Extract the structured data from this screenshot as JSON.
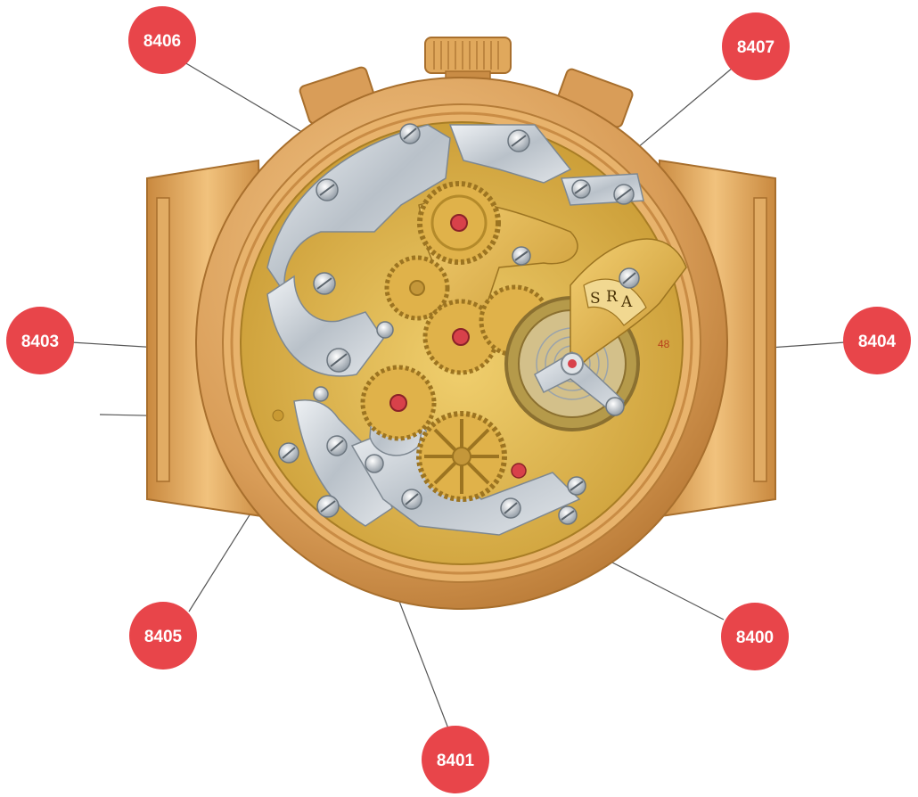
{
  "diagram": {
    "callouts": [
      {
        "id": "c8406",
        "label": "8406"
      },
      {
        "id": "c8407",
        "label": "8407"
      },
      {
        "id": "c8403",
        "label": "8403"
      },
      {
        "id": "c8404",
        "label": "8404"
      },
      {
        "id": "c8405",
        "label": "8405"
      },
      {
        "id": "c8400",
        "label": "8400"
      },
      {
        "id": "c8401",
        "label": "8401"
      }
    ],
    "regulator_scale_letters": [
      "S",
      "R",
      "A"
    ],
    "movement_engraving": "48",
    "colors": {
      "callout_fill": "#e8454a",
      "leader_line": "#555555",
      "case_gold": "#d99d58",
      "plate_gold": "#d9b04a",
      "steel": "#c6ccd2",
      "jewel": "#d8414a"
    }
  }
}
